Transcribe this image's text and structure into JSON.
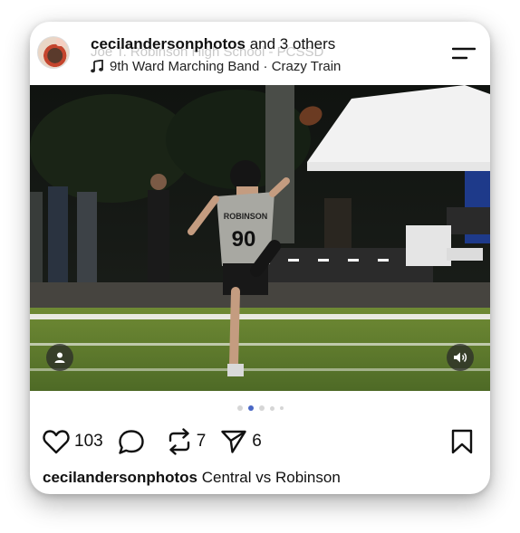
{
  "post": {
    "author": "cecilandersonphotos",
    "coauthors": "and 3 others",
    "ghost_location": "Joe T. Robinson High School - PCSSD",
    "music": "9th Ward Marching Band · Crazy Train",
    "jersey_text": "ROBINSON",
    "jersey_number": "90",
    "carousel": {
      "count": 5,
      "active_index": 1
    },
    "stats": {
      "likes": "103",
      "reposts": "7",
      "shares": "6"
    },
    "caption_user": "cecilandersonphotos",
    "caption_text": "Central vs Robinson"
  },
  "icons": {
    "avatar": "avatar",
    "music": "music-note-icon",
    "menu": "menu-icon",
    "person": "person-icon",
    "sound": "speaker-icon",
    "like": "heart-icon",
    "comment": "comment-icon",
    "repost": "repost-icon",
    "share": "send-icon",
    "save": "bookmark-icon"
  },
  "colors": {
    "accent_dot": "#4a67c5",
    "turf": "#5e7a2e",
    "tent": "#f2f2f2"
  }
}
